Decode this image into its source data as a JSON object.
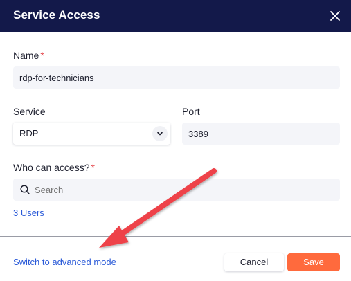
{
  "dialog": {
    "title": "Service Access",
    "close_icon": "close-icon"
  },
  "form": {
    "name": {
      "label": "Name",
      "required_mark": "*",
      "value": "rdp-for-technicians"
    },
    "service": {
      "label": "Service",
      "value": "RDP",
      "icon": "chevron-down-icon"
    },
    "port": {
      "label": "Port",
      "value": "3389"
    },
    "access": {
      "label": "Who can access?",
      "required_mark": "*",
      "search_placeholder": "Search",
      "search_icon": "search-icon",
      "users_link": "3 Users"
    }
  },
  "footer": {
    "advanced_link": "Switch to advanced mode",
    "cancel_label": "Cancel",
    "save_label": "Save"
  },
  "colors": {
    "header_bg": "#13194a",
    "required": "#e5484d",
    "link": "#2a5ad8",
    "save_bg": "#ff6a3d",
    "annotation_arrow": "#ee4348"
  }
}
